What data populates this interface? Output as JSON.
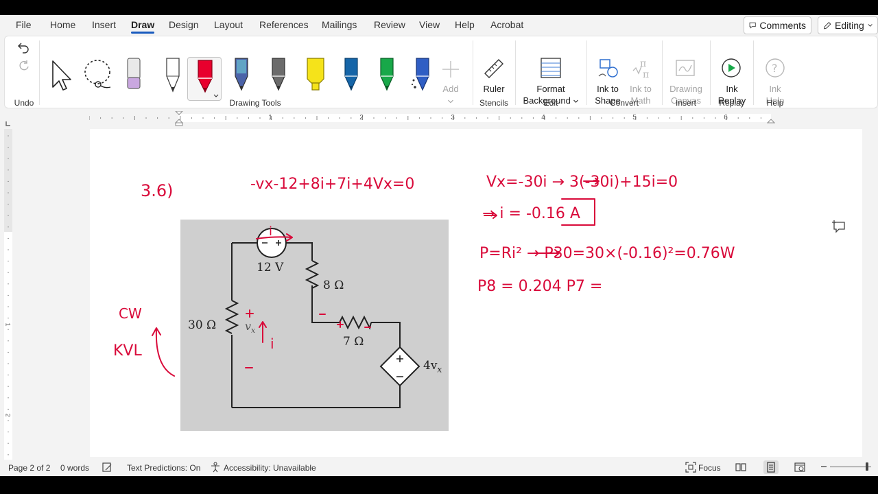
{
  "menu": {
    "tabs": [
      "File",
      "Home",
      "Insert",
      "Draw",
      "Design",
      "Layout",
      "References",
      "Mailings",
      "Review",
      "View",
      "Help",
      "Acrobat"
    ],
    "active": "Draw",
    "comments_label": "Comments",
    "editing_label": "Editing"
  },
  "ribbon": {
    "undo_group": "Undo",
    "drawing_tools_group": "Drawing Tools",
    "add_label": "Add",
    "ruler_label": "Ruler",
    "stencils_group": "Stencils",
    "format_bg_line1": "Format",
    "format_bg_line2": "Background",
    "edit_group": "Edit",
    "ink_to_shape_line1": "Ink to",
    "ink_to_shape_line2": "Shape",
    "ink_to_math_line1": "Ink to",
    "ink_to_math_line2": "Math",
    "convert_group": "Convert",
    "drawing_canvas_line1": "Drawing",
    "drawing_canvas_line2": "Canvas",
    "insert_group": "Insert",
    "ink_replay_line1": "Ink",
    "ink_replay_line2": "Replay",
    "replay_group": "Replay",
    "ink_help_line1": "Ink",
    "ink_help_line2": "Help",
    "help_group": "Help",
    "pen_colors": {
      "red": "#e8002d",
      "galaxy": "#5b6fb0",
      "gray": "#6b6b6b",
      "yellow": "#f5e31a",
      "blue": "#1565a8",
      "green": "#18a849",
      "sparkle": "#2f5ec4",
      "eraser": "#c9a7e0"
    }
  },
  "ruler": {
    "numbers": [
      "1",
      "2",
      "3",
      "4",
      "5",
      "6"
    ],
    "vnumbers": [
      "1",
      "2"
    ]
  },
  "document": {
    "problem_label": "3.6)",
    "kvl_equation": "-vx-12+8i+7i+4Vx=0",
    "vx_equation": "Vx=-30i → 3(-30i)+15i=0",
    "i_result": "→ i = -0.16 A",
    "power_line1": "P=Ri² → P30=30×(-0.16)²=0.76W",
    "power_line2": "P8 = 0.204 P7 =",
    "cw_label": "CW",
    "kvl_label": "KVL",
    "circuit": {
      "source_label": "12 V",
      "r8_label": "8 Ω",
      "r30_label": "30 Ω",
      "r7_label": "7 Ω",
      "dep_label": "4v",
      "dep_sub": "x",
      "vx_label": "v",
      "vx_sub": "x",
      "i_label": "i",
      "i_top_label": "i"
    },
    "ink_color": "#d90a3a"
  },
  "status": {
    "page": "Page 2 of 2",
    "words": "0 words",
    "text_predictions": "Text Predictions: On",
    "accessibility": "Accessibility: Unavailable",
    "focus": "Focus"
  }
}
